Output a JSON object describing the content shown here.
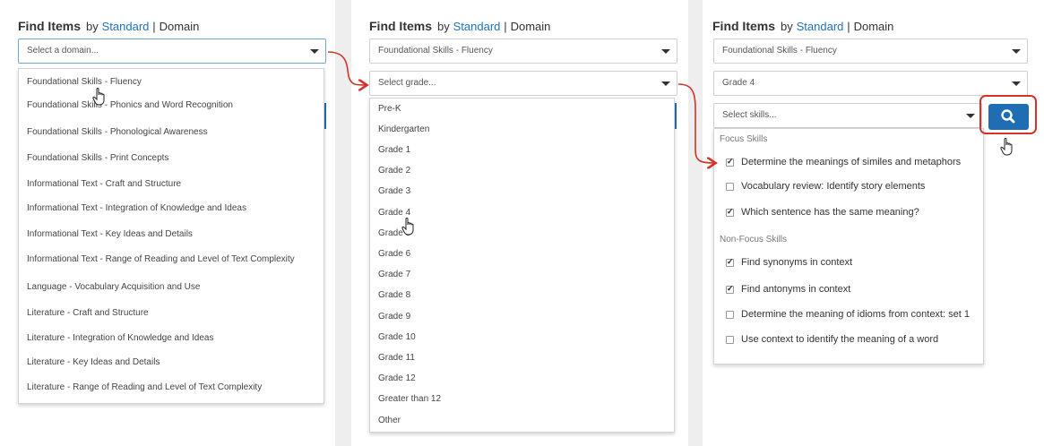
{
  "panels": [
    {
      "title": {
        "strong": "Find Items",
        "by": "by",
        "standard": "Standard",
        "sep": "|",
        "domain": "Domain"
      },
      "select_domain_placeholder": "Select a domain...",
      "domain_options": [
        "Foundational Skills - Fluency",
        "Foundational Skills - Phonics and Word Recognition",
        "Foundational Skills - Phonological Awareness",
        "Foundational Skills - Print Concepts",
        "Informational Text - Craft and Structure",
        "Informational Text - Integration of Knowledge and Ideas",
        "Informational Text - Key Ideas and Details",
        "Informational Text - Range of Reading and Level of Text Complexity",
        "Language - Vocabulary Acquisition and Use",
        "Literature - Craft and Structure",
        "Literature - Integration of Knowledge and Ideas",
        "Literature - Key Ideas and Details",
        "Literature - Range of Reading and Level of Text Complexity"
      ]
    },
    {
      "title": {
        "strong": "Find Items",
        "by": "by",
        "standard": "Standard",
        "sep": "|",
        "domain": "Domain"
      },
      "domain_value": "Foundational Skills - Fluency",
      "select_grade_placeholder": "Select grade...",
      "grade_options": [
        "Pre-K",
        "Kindergarten",
        "Grade 1",
        "Grade 2",
        "Grade 3",
        "Grade 4",
        "Grade 5",
        "Grade 6",
        "Grade 7",
        "Grade 8",
        "Grade 9",
        "Grade 10",
        "Grade 11",
        "Grade 12",
        "Greater than 12",
        "Other"
      ]
    },
    {
      "title": {
        "strong": "Find Items",
        "by": "by",
        "standard": "Standard",
        "sep": "|",
        "domain": "Domain"
      },
      "domain_value": "Foundational Skills - Fluency",
      "grade_value": "Grade 4",
      "select_skills_placeholder": "Select skills...",
      "focus_label": "Focus Skills",
      "focus_skills": [
        {
          "label": "Determine the meanings of similes and metaphors",
          "checked": true
        },
        {
          "label": "Vocabulary review: Identify story elements",
          "checked": false
        },
        {
          "label": "Which sentence has the same meaning?",
          "checked": true
        }
      ],
      "nonfocus_label": "Non-Focus Skills",
      "nonfocus_skills": [
        {
          "label": "Find synonyms in context",
          "checked": true
        },
        {
          "label": "Find antonyms in context",
          "checked": true
        },
        {
          "label": "Determine the meaning of idioms from context: set 1",
          "checked": false
        },
        {
          "label": "Use context to identify the meaning of a word",
          "checked": false
        }
      ]
    }
  ],
  "search_icon": "search-icon",
  "colors": {
    "link": "#1e73be",
    "primary": "#1f6db3",
    "highlight": "#d0342c",
    "arrow": "#d0342c"
  }
}
